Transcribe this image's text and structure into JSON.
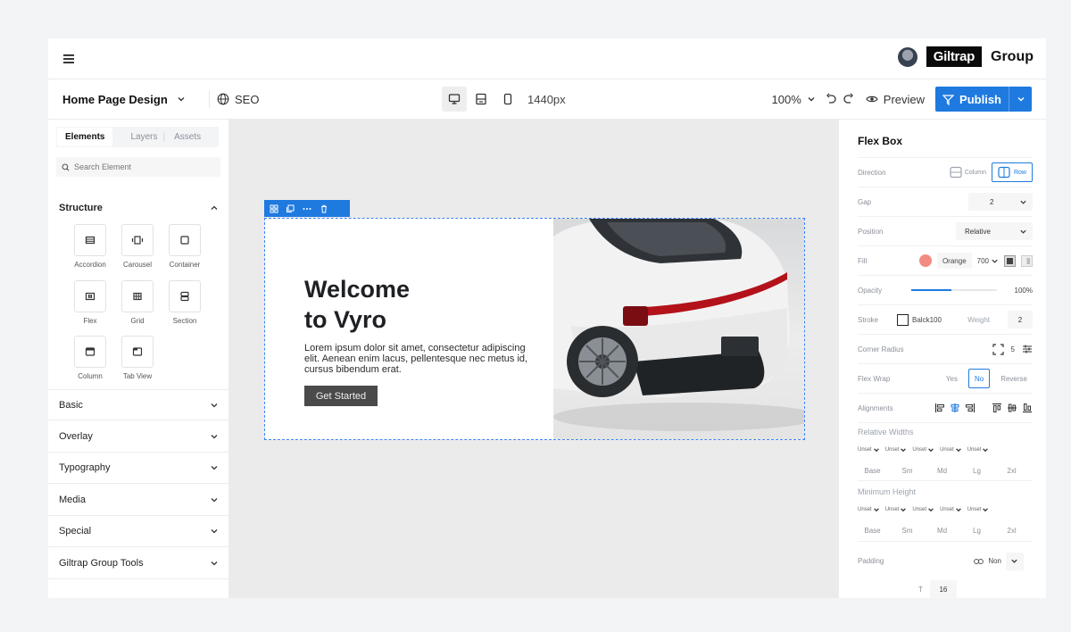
{
  "header": {
    "menu_icon": "hamburger-icon",
    "brand_box": "Giltrap",
    "brand_text": "Group"
  },
  "toolbar": {
    "page_name": "Home Page Design",
    "seo_label": "SEO",
    "width_label": "1440px",
    "zoom": "100%",
    "preview_label": "Preview",
    "publish_label": "Publish"
  },
  "sidebar": {
    "tabs": [
      "Elements",
      "Layers",
      "Assets"
    ],
    "tab_sep": "|",
    "search_placeholder": "Search Element",
    "structure_title": "Structure",
    "elements": [
      "Accordion",
      "Carousel",
      "Container",
      "Flex",
      "Grid",
      "Section",
      "Column",
      "Tab View"
    ],
    "sections": [
      "Basic",
      "Overlay",
      "Typography",
      "Media",
      "Special",
      "Giltrap Group Tools"
    ]
  },
  "hero": {
    "title_line1": "Welcome",
    "title_line2": "to Vyro",
    "description": "Lorem ipsum dolor sit amet, consectetur adipiscing elit. Aenean enim lacus, pellentesque nec metus id, cursus bibendum erat.",
    "button": "Get Started"
  },
  "panel": {
    "title": "Flex Box",
    "direction_label": "Direction",
    "direction_column": "Column",
    "direction_row": "Row",
    "gap_label": "Gap",
    "gap_value": "2",
    "position_label": "Position",
    "position_value": "Relative",
    "fill_label": "Fill",
    "fill_color_name": "Orange",
    "fill_shade": "700",
    "fill_color": "#f28b82",
    "opacity_label": "Opacity",
    "opacity_value": "100%",
    "stroke_label": "Stroke",
    "stroke_color": "Balck100",
    "weight_label": "Weight",
    "weight_value": "2",
    "radius_label": "Corner Radius",
    "radius_value": "5",
    "wrap_label": "Flex Wrap",
    "wrap_yes": "Yes",
    "wrap_no": "No",
    "wrap_reverse": "Reverse",
    "alignments_label": "Alignments",
    "rel_widths_label": "Relative Widths",
    "min_height_label": "Minimum Height",
    "unset": "Unset",
    "breakpoints": [
      "Base",
      "Sm",
      "Md",
      "Lg",
      "2xl"
    ],
    "padding_label": "Padding",
    "padding_value": "Non",
    "padding_t_label": "T",
    "padding_t_value": "16"
  },
  "colors": {
    "accent": "#1f7ae0",
    "canvas": "#ebebeb"
  }
}
